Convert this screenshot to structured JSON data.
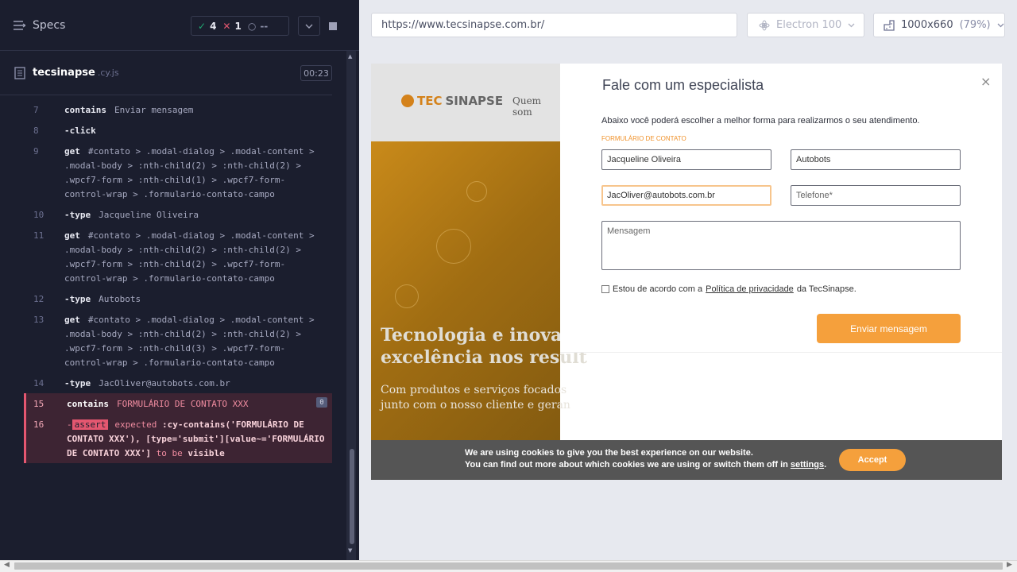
{
  "reporter": {
    "specs_label": "Specs",
    "stats": {
      "passed": "4",
      "failed": "1",
      "pending": "--"
    },
    "file": {
      "name": "tecsinapse",
      "ext": ".cy.js",
      "duration": "00:23"
    },
    "commands": [
      {
        "num": "7",
        "name": "contains",
        "arg": "Enviar mensagem"
      },
      {
        "num": "8",
        "name": "-click",
        "arg": ""
      },
      {
        "num": "9",
        "name": "get",
        "arg": "#contato > .modal-dialog > .modal-content > .modal-body > :nth-child(2) > :nth-child(2) > .wpcf7-form > :nth-child(1) > .wpcf7-form-control-wrap > .formulario-contato-campo"
      },
      {
        "num": "10",
        "name": "-type",
        "arg": "Jacqueline Oliveira"
      },
      {
        "num": "11",
        "name": "get",
        "arg": "#contato > .modal-dialog > .modal-content > .modal-body > :nth-child(2) > :nth-child(2) > .wpcf7-form > :nth-child(2) > .wpcf7-form-control-wrap > .formulario-contato-campo"
      },
      {
        "num": "12",
        "name": "-type",
        "arg": "Autobots"
      },
      {
        "num": "13",
        "name": "get",
        "arg": "#contato > .modal-dialog > .modal-content > .modal-body > :nth-child(2) > :nth-child(2) > .wpcf7-form > :nth-child(3) > .wpcf7-form-control-wrap > .formulario-contato-campo"
      },
      {
        "num": "14",
        "name": "-type",
        "arg": "JacOliver@autobots.com.br"
      }
    ],
    "failed_contains": {
      "num": "15",
      "name": "contains",
      "arg": "FORMULÁRIO DE CONTATO XXX",
      "badge": "0"
    },
    "failed_assert": {
      "num": "16",
      "pill": "assert",
      "word1": "expected",
      "selector": ":cy-contains('FORMULÁRIO DE CONTATO XXX'), [type='submit'][value~='FORMULÁRIO DE CONTATO XXX']",
      "word2": "to be",
      "word3": "visible"
    }
  },
  "toolbar": {
    "url": "https://www.tecsinapse.com.br/",
    "browser": "Electron 100",
    "viewport": "1000x660",
    "scale": "(79%)"
  },
  "site": {
    "logo_a": "TEC",
    "logo_b": "SINAPSE",
    "nav": "Quem som",
    "hero_title_1": "Tecnologia e inovaçã",
    "hero_title_2": "excelência nos result",
    "hero_sub_1": "Com produtos e serviços focados",
    "hero_sub_2": "junto com o nosso cliente e geran",
    "modal": {
      "title": "Fale com um especialista",
      "close": "×",
      "intro": "Abaixo você poderá escolher a melhor forma para realizarmos o seu atendimento.",
      "label": "FORMULÁRIO DE CONTATO",
      "name": "Jacqueline Oliveira",
      "company": "Autobots",
      "email": "JacOliver@autobots.com.br",
      "phone": "Telefone*",
      "message": "Mensagem",
      "consent_a": "Estou de acordo com a",
      "consent_link": "Política de privacidade",
      "consent_b": "da TecSinapse.",
      "send": "Enviar mensagem"
    },
    "cookie": {
      "line1": "We are using cookies to give you the best experience on our website.",
      "line2": "You can find out more about which cookies we are using or switch them off in",
      "link": "settings",
      "dot": ".",
      "accept": "Accept"
    }
  }
}
